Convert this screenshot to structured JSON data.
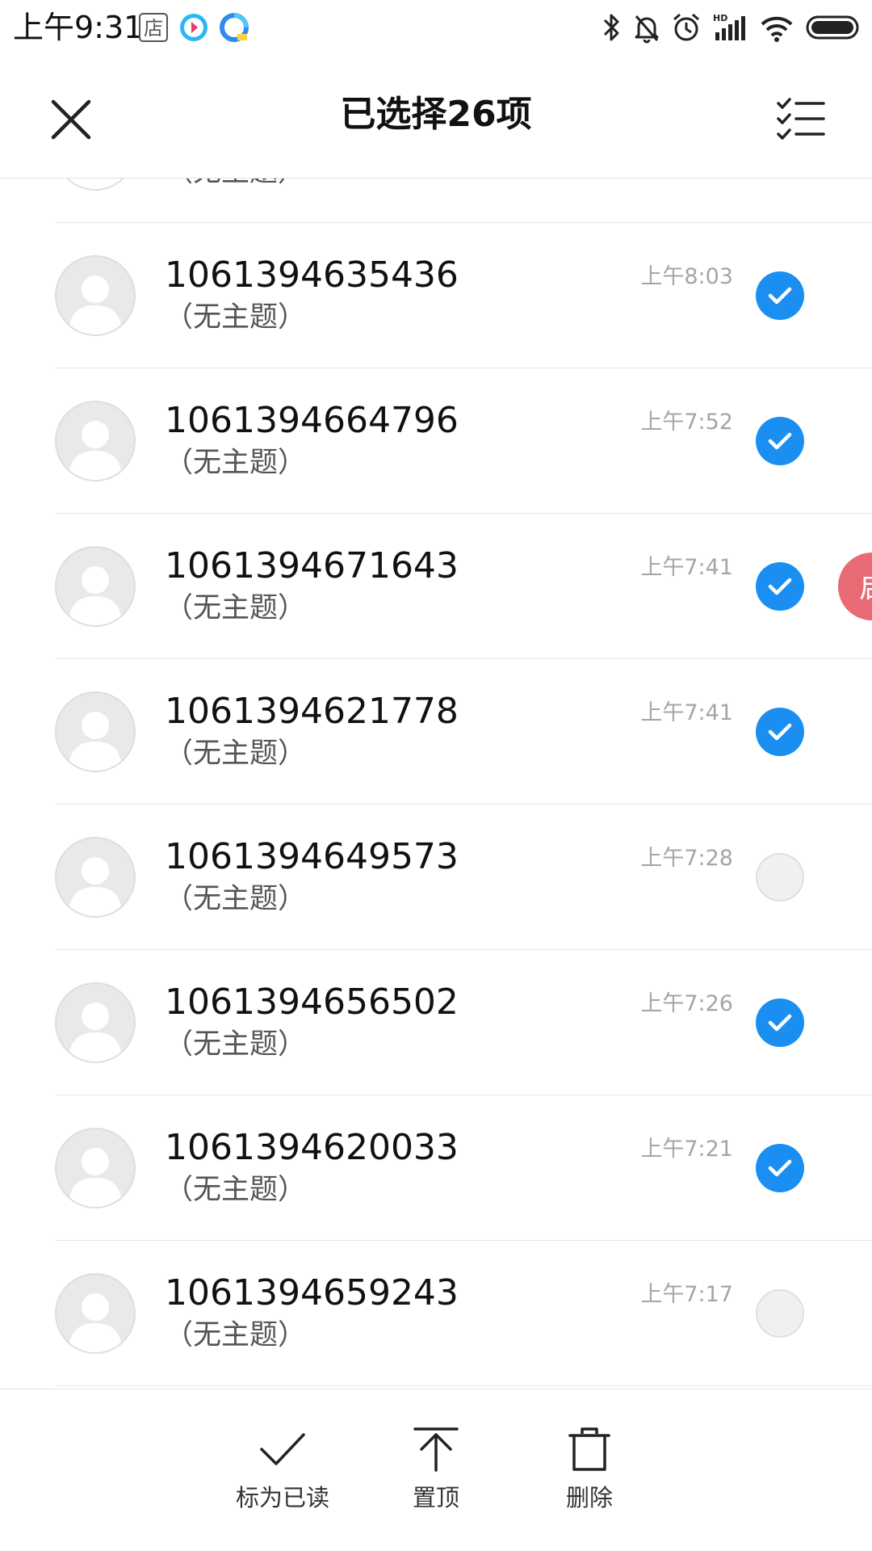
{
  "status_bar": {
    "time": "上午9:31",
    "app_icons": [
      "store-app-icon",
      "video-app-icon",
      "browser-app-icon"
    ],
    "right_icons": [
      "bluetooth-icon",
      "mute-icon",
      "alarm-icon",
      "hd-signal-icon",
      "wifi-icon",
      "battery-icon"
    ],
    "store_glyph": "店",
    "hd_label": "HD"
  },
  "header": {
    "title": "已选择26项",
    "close_icon": "close-icon",
    "select_all_icon": "select-all-list-icon"
  },
  "colors": {
    "accent": "#1a8ff1",
    "badge": "#e86a74",
    "time_gray": "#a5a5a5"
  },
  "messages": [
    {
      "sender": "",
      "subject": "（无主题）",
      "time": "",
      "checked": true
    },
    {
      "sender": "1061394635436",
      "subject": "（无主题）",
      "time": "上午8:03",
      "checked": true
    },
    {
      "sender": "1061394664796",
      "subject": "（无主题）",
      "time": "上午7:52",
      "checked": true
    },
    {
      "sender": "1061394671643",
      "subject": "（无主题）",
      "time": "上午7:41",
      "checked": true
    },
    {
      "sender": "1061394621778",
      "subject": "（无主题）",
      "time": "上午7:41",
      "checked": true
    },
    {
      "sender": "1061394649573",
      "subject": "（无主题）",
      "time": "上午7:28",
      "checked": false
    },
    {
      "sender": "1061394656502",
      "subject": "（无主题）",
      "time": "上午7:26",
      "checked": true
    },
    {
      "sender": "1061394620033",
      "subject": "（无主题）",
      "time": "上午7:21",
      "checked": true
    },
    {
      "sender": "1061394659243",
      "subject": "（无主题）",
      "time": "上午7:17",
      "checked": false
    }
  ],
  "float_badge": {
    "glyph": "启"
  },
  "bottom_actions": [
    {
      "label": "标为已读",
      "icon": "checkmark-icon"
    },
    {
      "label": "置顶",
      "icon": "pin-to-top-icon"
    },
    {
      "label": "删除",
      "icon": "trash-icon"
    }
  ]
}
